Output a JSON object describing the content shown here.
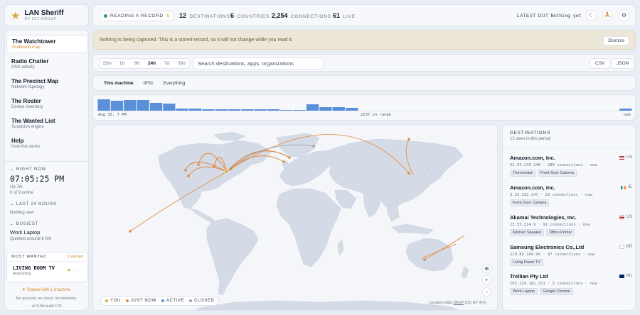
{
  "app": {
    "name": "LAN Sheriff",
    "byline": "BY 291 GROUP",
    "logo_icon": "star-icon"
  },
  "sidebar": {
    "nav": [
      {
        "label": "The Watchtower",
        "sub": "Outbound map",
        "active": true
      },
      {
        "label": "Radio Chatter",
        "sub": "DNS activity"
      },
      {
        "label": "The Precinct Map",
        "sub": "Network topology"
      },
      {
        "label": "The Roster",
        "sub": "Device inventory"
      },
      {
        "label": "The Wanted List",
        "sub": "Suspicion engine"
      },
      {
        "label": "Help",
        "sub": "How this works"
      }
    ],
    "right_now": {
      "header": "RIGHT NOW",
      "time": "07:05:25 PM",
      "uptime": "Up 7m",
      "online": "0 of 9 online"
    },
    "last24": {
      "header": "LAST 24 HOURS",
      "text": "Nothing new"
    },
    "busiest": {
      "header": "BUSIEST",
      "device": "Work Laptop",
      "note": "Quietest around 6 AM"
    },
    "most_wanted": {
      "header": "MOST WANTED",
      "count": "1 wanted",
      "name": "LIVING ROOM TV",
      "status": "beaconing",
      "stars": 1,
      "stars_max": 3
    },
    "shared": "Shared with 1 machine.",
    "privacy": "No account, no cloud, no telemetry.",
    "version": "v0.9.8b build 170"
  },
  "topbar": {
    "recording": "READING A RECORD",
    "stats": [
      {
        "value": "12",
        "label": "DESTINATIONS"
      },
      {
        "value": "6",
        "label": "COUNTRIES"
      },
      {
        "value": "2,254",
        "label": "CONNECTIONS"
      },
      {
        "value": "61",
        "label": "LIVE"
      }
    ],
    "latest_out_label": "LATEST OUT",
    "latest_out_value": "Nothing yet"
  },
  "notice": {
    "message": "Nothing is being captured. This is a stored record, so it will not change while you read it.",
    "dismiss": "Dismiss"
  },
  "controls": {
    "ranges": [
      "15m",
      "1h",
      "6h",
      "24h",
      "7d",
      "30d"
    ],
    "selected_range": "24h",
    "search_placeholder": "Search destinations, apps, organizations",
    "export": [
      "CSV",
      "JSON"
    ]
  },
  "machine_tabs": [
    "This machine",
    "IPS1",
    "Everything"
  ],
  "histogram": {
    "start_label": "Aug 15, 7 PM",
    "range_label": "2237 in range",
    "end_label": "now",
    "bar_color": "#5b8fd8",
    "values": [
      16,
      14,
      15,
      15,
      11,
      10,
      3,
      3,
      2,
      2,
      2,
      2,
      2,
      2,
      1,
      1,
      9,
      5,
      5,
      4,
      0,
      0,
      0,
      0,
      0,
      0,
      0,
      0,
      0,
      0,
      0,
      0,
      0,
      0,
      0,
      0,
      0,
      0,
      0,
      0,
      3
    ],
    "max": 16
  },
  "map": {
    "legend": [
      {
        "label": "YOU",
        "color": "#d6a93c"
      },
      {
        "label": "JUST NOW",
        "color": "#e08a3c"
      },
      {
        "label": "ACTIVE",
        "color": "#5b8fd8"
      },
      {
        "label": "CLOSED",
        "color": "#9aa3af"
      }
    ],
    "attribution_prefix": "Location data",
    "attribution_link": "DB-IP",
    "attribution_suffix": "(CC BY 4.0)",
    "land_color": "#d5dbe6",
    "arc_color": "#e08a3c"
  },
  "destinations": {
    "header": "DESTINATIONS",
    "subheader": "12 seen in this period",
    "items": [
      {
        "org": "Amazon.com, Inc.",
        "country": "US",
        "meta": "52.94.236.248 · 289 connections · now",
        "tags": [
          "Thermostat",
          "Front Door Camera"
        ]
      },
      {
        "org": "Amazon.com, Inc.",
        "country": "IE",
        "meta": "3.33.152.147 · 29 connections · now",
        "tags": [
          "Front Door Camera"
        ]
      },
      {
        "org": "Akamai Technologies, Inc.",
        "country": "US",
        "meta": "23.55.214.9 · 91 connections · now",
        "tags": [
          "Kitchen Speaker",
          "Office Printer"
        ]
      },
      {
        "org": "Samsung Electronics Co.,Ltd",
        "country": "KR",
        "meta": "210.89.164.90 · 87 connections · now",
        "tags": [
          "Living Room TV"
        ]
      },
      {
        "org": "Trellian Pty Ltd",
        "country": "AU",
        "meta": "103.224.182.251 · 3 connections · now",
        "tags": [
          "Work Laptop",
          "Google Chrome"
        ]
      }
    ]
  }
}
